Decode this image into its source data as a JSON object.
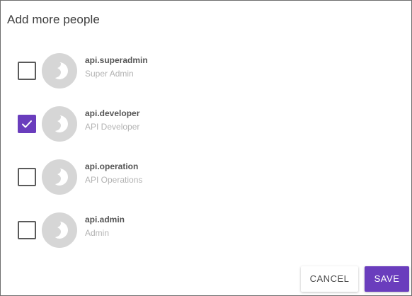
{
  "dialog": {
    "title": "Add more people",
    "people": [
      {
        "username": "api.superadmin",
        "role": "Super Admin",
        "checked": false
      },
      {
        "username": "api.developer",
        "role": "API Developer",
        "checked": true
      },
      {
        "username": "api.operation",
        "role": "API Operations",
        "checked": false
      },
      {
        "username": "api.admin",
        "role": "Admin",
        "checked": false
      }
    ],
    "cancel_label": "CANCEL",
    "save_label": "SAVE"
  },
  "colors": {
    "accent": "#6a3dbd",
    "avatar": "#d6d6d6"
  },
  "icons": {
    "avatar": "wso2-logo-icon",
    "check": "checkmark-icon"
  }
}
